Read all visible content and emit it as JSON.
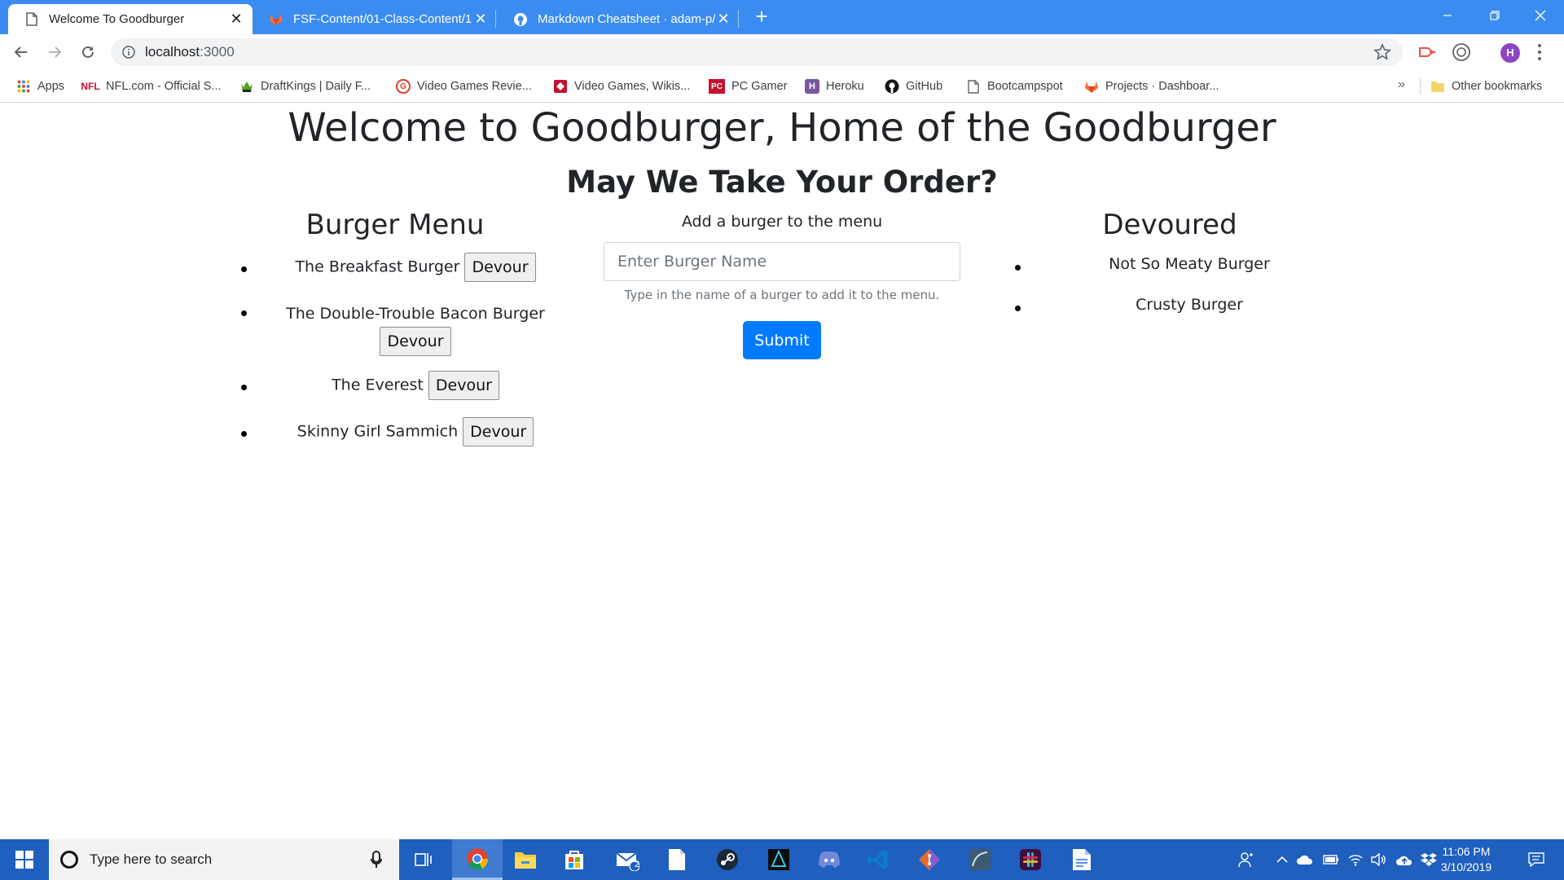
{
  "browser": {
    "tabs": [
      {
        "title": "Welcome To Goodburger",
        "icon": "page-icon",
        "active": true
      },
      {
        "title": "FSF-Content/01-Class-Content/1",
        "icon": "gitlab-icon",
        "active": false
      },
      {
        "title": "Markdown Cheatsheet · adam-p/",
        "icon": "github-icon",
        "active": false
      }
    ],
    "url_host": "localhost",
    "url_port": ":3000",
    "profile_initial": "H",
    "bookmarks": [
      {
        "label": "Apps",
        "icon": "apps-grid-icon"
      },
      {
        "label": "NFL.com - Official S...",
        "icon": "nfl-icon",
        "icon_text": "NFL"
      },
      {
        "label": "DraftKings | Daily F...",
        "icon": "draftkings-icon"
      },
      {
        "label": "Video Games Revie...",
        "icon": "gamespot-icon",
        "icon_text": "G"
      },
      {
        "label": "Video Games, Wikis...",
        "icon": "fandom-icon"
      },
      {
        "label": "PC Gamer",
        "icon": "pcgamer-icon",
        "icon_text": "PC"
      },
      {
        "label": "Heroku",
        "icon": "heroku-icon",
        "icon_text": "H"
      },
      {
        "label": "GitHub",
        "icon": "github-icon"
      },
      {
        "label": "Bootcampspot",
        "icon": "page-icon"
      },
      {
        "label": "Projects · Dashboar...",
        "icon": "gitlab-icon"
      }
    ],
    "bookmarks_overflow": "»",
    "other_bookmarks": "Other bookmarks"
  },
  "page": {
    "title": "Welcome to Goodburger, Home of the Goodburger",
    "subtitle": "May We Take Your Order?",
    "menu": {
      "heading": "Burger Menu",
      "items": [
        {
          "name": "The Breakfast Burger",
          "button": "Devour"
        },
        {
          "name": "The Double-Trouble Bacon Burger",
          "button": "Devour"
        },
        {
          "name": "The Everest",
          "button": "Devour"
        },
        {
          "name": "Skinny Girl Sammich",
          "button": "Devour"
        }
      ]
    },
    "form": {
      "label": "Add a burger to the menu",
      "placeholder": "Enter Burger Name",
      "help": "Type in the name of a burger to add it to the menu.",
      "submit": "Submit"
    },
    "devoured": {
      "heading": "Devoured",
      "items": [
        "Not So Meaty Burger",
        "Crusty Burger"
      ]
    }
  },
  "taskbar": {
    "search_placeholder": "Type here to search",
    "apps": [
      "task-view-icon",
      "chrome-icon",
      "file-explorer-icon",
      "store-icon",
      "mail-icon",
      "notepad-icon",
      "steam-icon",
      "tempest-icon",
      "discord-icon",
      "vscode-icon",
      "git-icon",
      "mysql-workbench-icon",
      "slack-icon",
      "docs-icon"
    ],
    "mail_badge": "2",
    "time": "11:06 PM",
    "date": "3/10/2019"
  },
  "colors": {
    "tabstrip": "#3b8cf0",
    "taskbar": "#1f5fbd",
    "primary_button": "#007bff"
  }
}
